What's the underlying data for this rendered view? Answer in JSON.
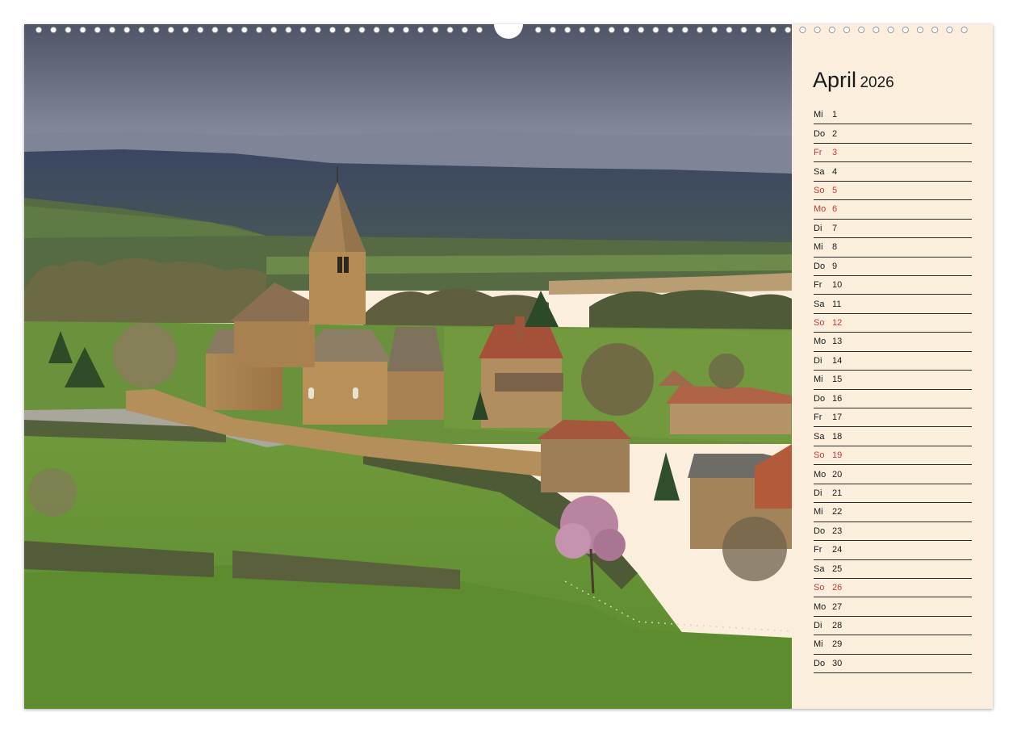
{
  "calendar": {
    "month": "April",
    "year": "2026",
    "days": [
      {
        "wd": "Mi",
        "d": "1",
        "red": false
      },
      {
        "wd": "Do",
        "d": "2",
        "red": false
      },
      {
        "wd": "Fr",
        "d": "3",
        "red": true
      },
      {
        "wd": "Sa",
        "d": "4",
        "red": false
      },
      {
        "wd": "So",
        "d": "5",
        "red": true
      },
      {
        "wd": "Mo",
        "d": "6",
        "red": true
      },
      {
        "wd": "Di",
        "d": "7",
        "red": false
      },
      {
        "wd": "Mi",
        "d": "8",
        "red": false
      },
      {
        "wd": "Do",
        "d": "9",
        "red": false
      },
      {
        "wd": "Fr",
        "d": "10",
        "red": false
      },
      {
        "wd": "Sa",
        "d": "11",
        "red": false
      },
      {
        "wd": "So",
        "d": "12",
        "red": true
      },
      {
        "wd": "Mo",
        "d": "13",
        "red": false
      },
      {
        "wd": "Di",
        "d": "14",
        "red": false
      },
      {
        "wd": "Mi",
        "d": "15",
        "red": false
      },
      {
        "wd": "Do",
        "d": "16",
        "red": false
      },
      {
        "wd": "Fr",
        "d": "17",
        "red": false
      },
      {
        "wd": "Sa",
        "d": "18",
        "red": false
      },
      {
        "wd": "So",
        "d": "19",
        "red": true
      },
      {
        "wd": "Mo",
        "d": "20",
        "red": false
      },
      {
        "wd": "Di",
        "d": "21",
        "red": false
      },
      {
        "wd": "Mi",
        "d": "22",
        "red": false
      },
      {
        "wd": "Do",
        "d": "23",
        "red": false
      },
      {
        "wd": "Fr",
        "d": "24",
        "red": false
      },
      {
        "wd": "Sa",
        "d": "25",
        "red": false
      },
      {
        "wd": "So",
        "d": "26",
        "red": true
      },
      {
        "wd": "Mo",
        "d": "27",
        "red": false
      },
      {
        "wd": "Di",
        "d": "28",
        "red": false
      },
      {
        "wd": "Mi",
        "d": "29",
        "red": false
      },
      {
        "wd": "Do",
        "d": "30",
        "red": false
      }
    ]
  },
  "colors": {
    "panel": "#fbeedd",
    "text": "#1a1a1a",
    "holiday": "#c23b37",
    "rule": "#2b2b2b"
  }
}
